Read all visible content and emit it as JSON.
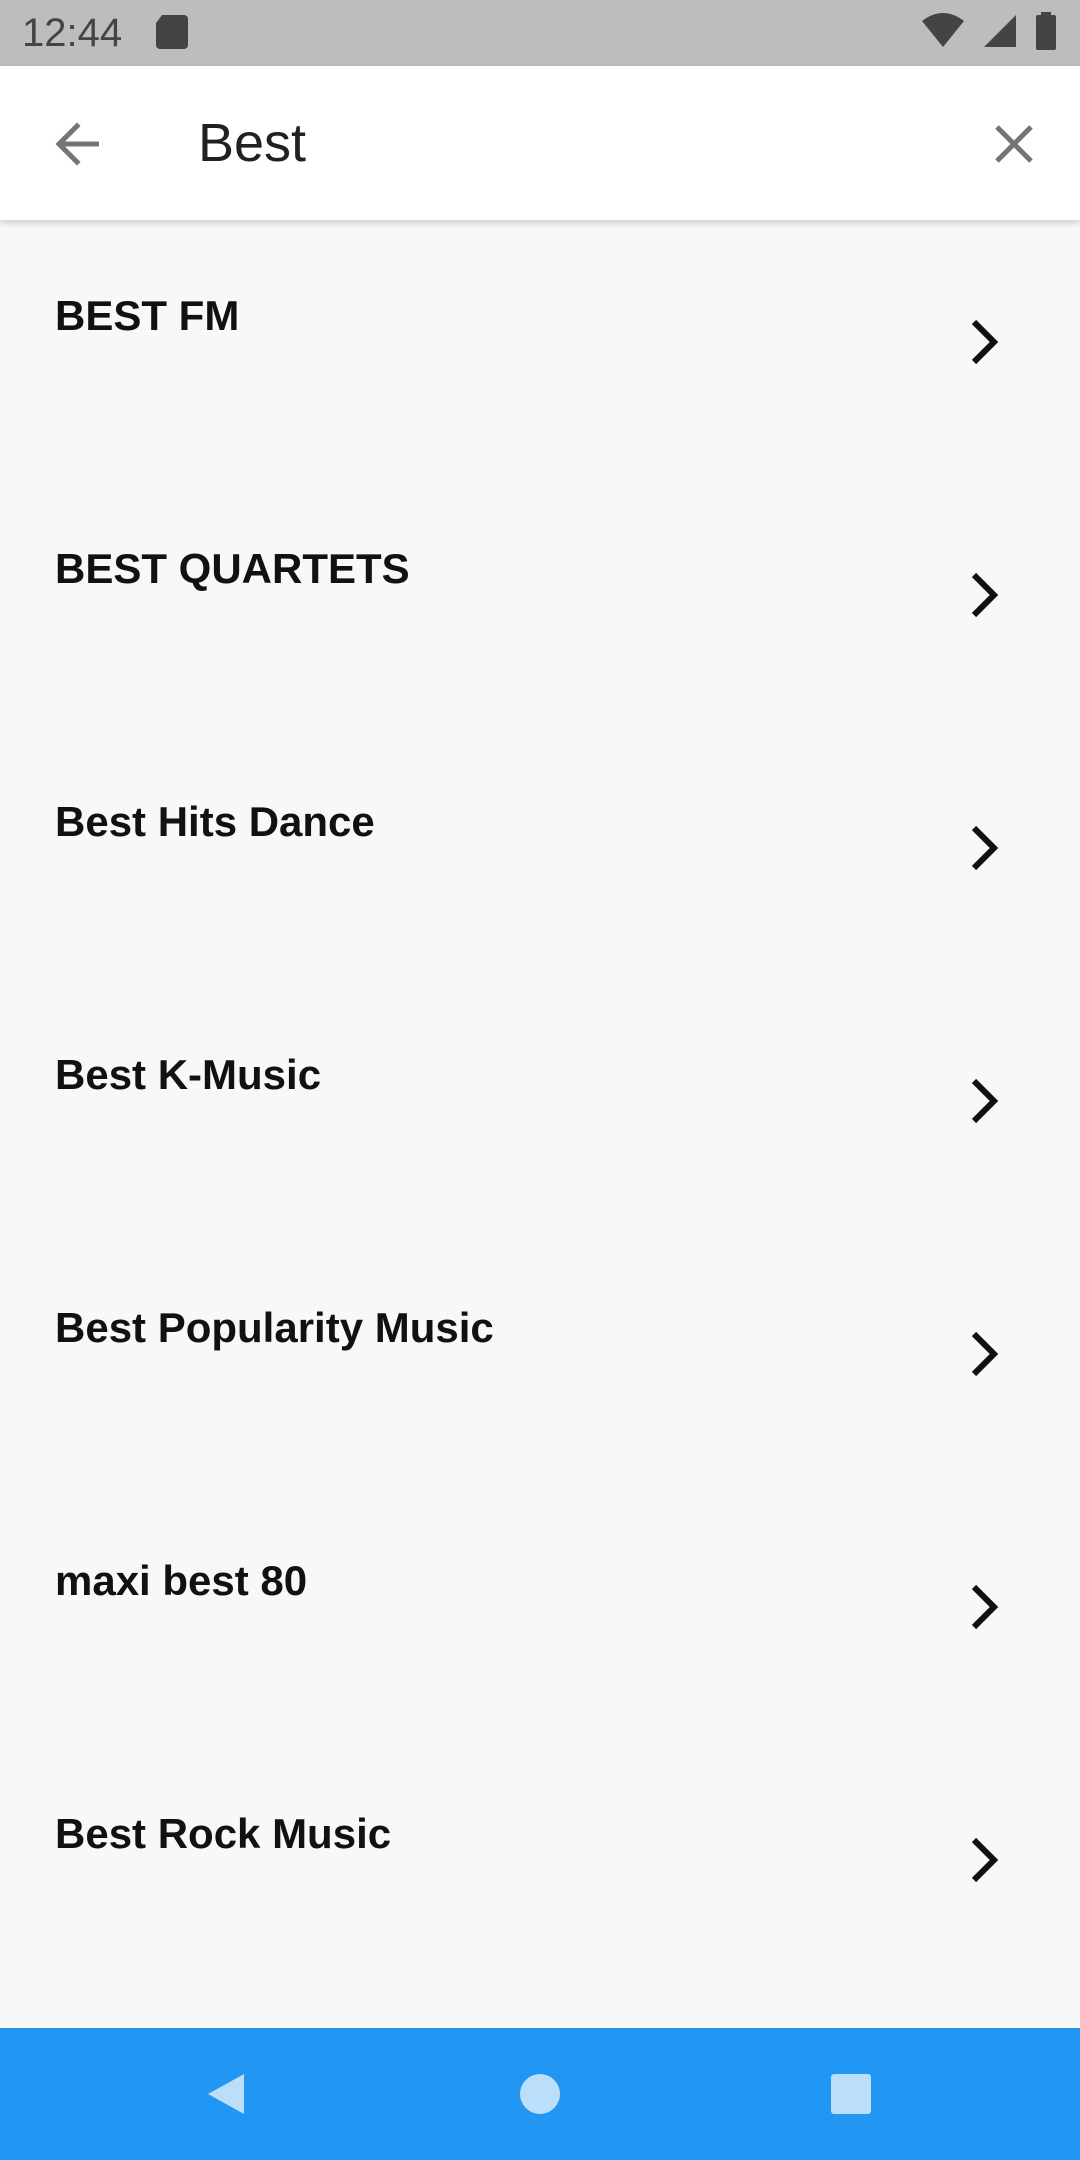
{
  "status_bar": {
    "time": "12:44",
    "icons": [
      "sd-card-icon",
      "wifi-icon",
      "signal-icon",
      "battery-icon"
    ]
  },
  "search": {
    "query": "Best",
    "back_icon": "arrow-back-icon",
    "clear_icon": "close-icon"
  },
  "results": [
    {
      "title": "BEST FM"
    },
    {
      "title": "BEST QUARTETS"
    },
    {
      "title": "Best Hits Dance"
    },
    {
      "title": "Best K-Music"
    },
    {
      "title": "Best Popularity Music"
    },
    {
      "title": "maxi best 80"
    },
    {
      "title": "Best Rock Music"
    }
  ],
  "nav_bar": {
    "color": "#2196f3",
    "buttons": [
      "back-triangle-icon",
      "home-circle-icon",
      "recents-square-icon"
    ]
  }
}
